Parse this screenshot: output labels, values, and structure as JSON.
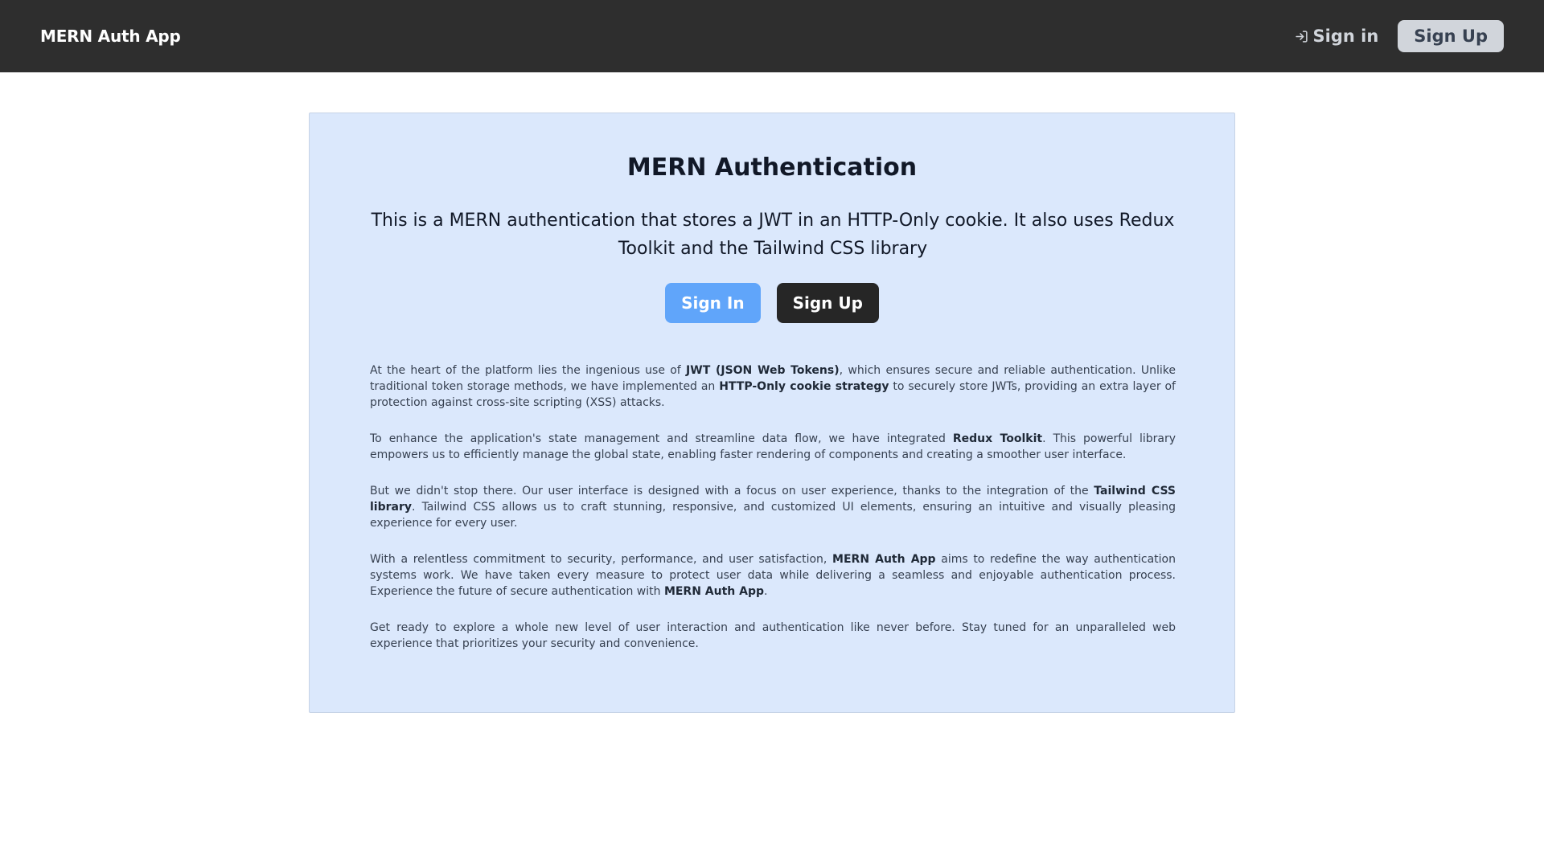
{
  "header": {
    "brand": "MERN Auth App",
    "signin_label": "Sign in",
    "signup_label": "Sign Up"
  },
  "hero": {
    "title": "MERN Authentication",
    "description": "This is a MERN authentication that stores a JWT in an HTTP-Only cookie. It also uses Redux Toolkit and the Tailwind CSS library",
    "signin_button": "Sign In",
    "signup_button": "Sign Up"
  },
  "paragraphs": [
    [
      {
        "t": "At the heart of the platform lies the ingenious use of "
      },
      {
        "t": "JWT (JSON Web Tokens)",
        "b": true
      },
      {
        "t": ", which ensures secure and reliable authentication. Unlike traditional token storage methods, we have implemented an "
      },
      {
        "t": "HTTP-Only cookie strategy",
        "b": true
      },
      {
        "t": " to securely store JWTs, providing an extra layer of protection against cross-site scripting (XSS) attacks."
      }
    ],
    [
      {
        "t": "To enhance the application's state management and streamline data flow, we have integrated "
      },
      {
        "t": "Redux Toolkit",
        "b": true
      },
      {
        "t": ". This powerful library empowers us to efficiently manage the global state, enabling faster rendering of components and creating a smoother user interface."
      }
    ],
    [
      {
        "t": "But we didn't stop there. Our user interface is designed with a focus on user experience, thanks to the integration of the "
      },
      {
        "t": "Tailwind CSS library",
        "b": true
      },
      {
        "t": ". Tailwind CSS allows us to craft stunning, responsive, and customized UI elements, ensuring an intuitive and visually pleasing experience for every user."
      }
    ],
    [
      {
        "t": "With a relentless commitment to security, performance, and user satisfaction, "
      },
      {
        "t": "MERN Auth App",
        "b": true
      },
      {
        "t": " aims to redefine the way authentication systems work. We have taken every measure to protect user data while delivering a seamless and enjoyable authentication process. Experience the future of secure authentication with "
      },
      {
        "t": "MERN Auth App",
        "b": true
      },
      {
        "t": "."
      }
    ],
    [
      {
        "t": "Get ready to explore a whole new level of user interaction and authentication like never before. Stay tuned for an unparalleled web experience that prioritizes your security and convenience."
      }
    ]
  ],
  "icons": {
    "signin": "login-arrow-icon"
  },
  "colors": {
    "header_bg": "#2e2e2e",
    "card_bg": "#dbe8fc",
    "primary_button": "#60a5fa",
    "dark_button": "#262626",
    "nav_signup_bg": "#d1d5db"
  }
}
